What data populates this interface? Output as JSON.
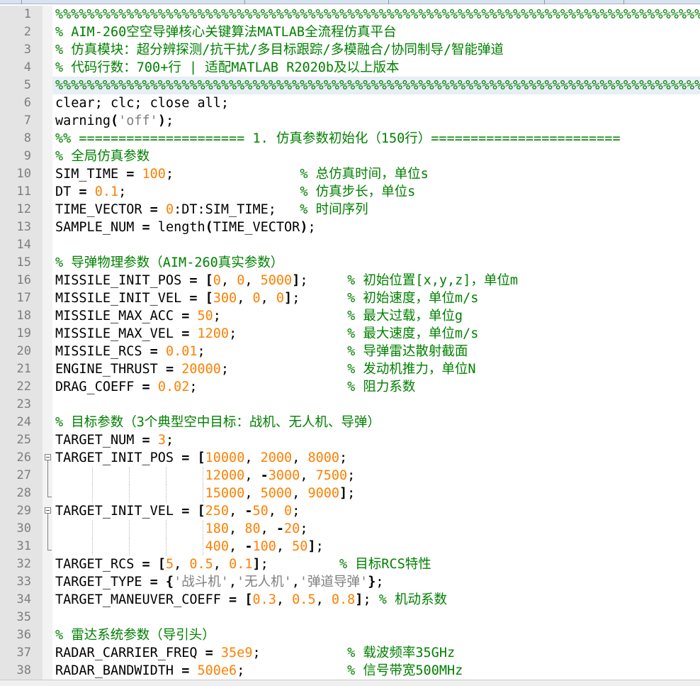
{
  "editor": {
    "current_line": 5,
    "lines": [
      {
        "n": "1",
        "tokens": [
          [
            "c-com",
            "%%%%%%%%%%%%%%%%%%%%%%%%%%%%%%%%%%%%%%%%%%%%%%%%%%%%%%%%%%%%%%%%%%%%%%%%%%%%%%%%%%%%"
          ]
        ]
      },
      {
        "n": "2",
        "tokens": [
          [
            "c-com",
            "% AIM-260空空导弹核心关键算法MATLAB全流程仿真平台"
          ]
        ]
      },
      {
        "n": "3",
        "tokens": [
          [
            "c-com",
            "% 仿真模块：超分辨探测/抗干扰/多目标跟踪/多模融合/协同制导/智能弹道"
          ]
        ]
      },
      {
        "n": "4",
        "tokens": [
          [
            "c-com",
            "% 代码行数：700+行 | 适配MATLAB R2020b及以上版本"
          ]
        ]
      },
      {
        "n": "5",
        "tokens": [
          [
            "c-com",
            "%%%%%%%%%%%%%%%%%%%%%%%%%%%%%%%%%%%%%%%%%%%%%%%%%%%%%%%%%%%%%%%%%%%%%%%%%%%%%%%%%%%%"
          ]
        ]
      },
      {
        "n": "6",
        "tokens": [
          [
            "",
            "clear; clc; close all;"
          ]
        ]
      },
      {
        "n": "7",
        "tokens": [
          [
            "",
            "warning"
          ],
          [
            "c-op",
            "("
          ],
          [
            "c-str",
            "'off'"
          ],
          [
            "c-op",
            ")"
          ],
          [
            "",
            ";"
          ]
        ]
      },
      {
        "n": "8",
        "tokens": [
          [
            "c-com",
            "%% ===================== 1. 仿真参数初始化（150行）========================"
          ]
        ]
      },
      {
        "n": "9",
        "tokens": [
          [
            "c-com",
            "% 全局仿真参数"
          ]
        ]
      },
      {
        "n": "10",
        "tokens": [
          [
            "",
            "SIM_TIME "
          ],
          [
            "c-op",
            "="
          ],
          [
            "",
            " "
          ],
          [
            "c-num",
            "100"
          ],
          [
            "",
            ";                "
          ],
          [
            "c-com",
            "% 总仿真时间，单位s"
          ]
        ]
      },
      {
        "n": "11",
        "tokens": [
          [
            "",
            "DT "
          ],
          [
            "c-op",
            "="
          ],
          [
            "",
            " "
          ],
          [
            "c-num",
            "0.1"
          ],
          [
            "",
            ";                      "
          ],
          [
            "c-com",
            "% 仿真步长，单位s"
          ]
        ]
      },
      {
        "n": "12",
        "tokens": [
          [
            "",
            "TIME_VECTOR "
          ],
          [
            "c-op",
            "="
          ],
          [
            "",
            " "
          ],
          [
            "c-num",
            "0"
          ],
          [
            "",
            ":DT:SIM_TIME;   "
          ],
          [
            "c-com",
            "% 时间序列"
          ]
        ]
      },
      {
        "n": "13",
        "tokens": [
          [
            "",
            "SAMPLE_NUM "
          ],
          [
            "c-op",
            "="
          ],
          [
            "",
            " length"
          ],
          [
            "c-op",
            "("
          ],
          [
            "",
            "TIME_VECTOR"
          ],
          [
            "c-op",
            ")"
          ],
          [
            "",
            ";"
          ]
        ]
      },
      {
        "n": "14",
        "tokens": [
          [
            "",
            ""
          ]
        ]
      },
      {
        "n": "15",
        "tokens": [
          [
            "c-com",
            "% 导弹物理参数（AIM-260真实参数）"
          ]
        ]
      },
      {
        "n": "16",
        "tokens": [
          [
            "",
            "MISSILE_INIT_POS "
          ],
          [
            "c-op",
            "= ["
          ],
          [
            "c-num",
            "0"
          ],
          [
            "",
            ", "
          ],
          [
            "c-num",
            "0"
          ],
          [
            "",
            ", "
          ],
          [
            "c-num",
            "5000"
          ],
          [
            "c-op",
            "]"
          ],
          [
            "",
            ";     "
          ],
          [
            "c-com",
            "% 初始位置[x,y,z]，单位m"
          ]
        ]
      },
      {
        "n": "17",
        "tokens": [
          [
            "",
            "MISSILE_INIT_VEL "
          ],
          [
            "c-op",
            "= ["
          ],
          [
            "c-num",
            "300"
          ],
          [
            "",
            ", "
          ],
          [
            "c-num",
            "0"
          ],
          [
            "",
            ", "
          ],
          [
            "c-num",
            "0"
          ],
          [
            "c-op",
            "]"
          ],
          [
            "",
            ";      "
          ],
          [
            "c-com",
            "% 初始速度，单位m/s"
          ]
        ]
      },
      {
        "n": "18",
        "tokens": [
          [
            "",
            "MISSILE_MAX_ACC "
          ],
          [
            "c-op",
            "="
          ],
          [
            "",
            " "
          ],
          [
            "c-num",
            "50"
          ],
          [
            "",
            ";                "
          ],
          [
            "c-com",
            "% 最大过载，单位g"
          ]
        ]
      },
      {
        "n": "19",
        "tokens": [
          [
            "",
            "MISSILE_MAX_VEL "
          ],
          [
            "c-op",
            "="
          ],
          [
            "",
            " "
          ],
          [
            "c-num",
            "1200"
          ],
          [
            "",
            ";              "
          ],
          [
            "c-com",
            "% 最大速度，单位m/s"
          ]
        ]
      },
      {
        "n": "20",
        "tokens": [
          [
            "",
            "MISSILE_RCS "
          ],
          [
            "c-op",
            "="
          ],
          [
            "",
            " "
          ],
          [
            "c-num",
            "0.01"
          ],
          [
            "",
            ";                  "
          ],
          [
            "c-com",
            "% 导弹雷达散射截面"
          ]
        ]
      },
      {
        "n": "21",
        "tokens": [
          [
            "",
            "ENGINE_THRUST "
          ],
          [
            "c-op",
            "="
          ],
          [
            "",
            " "
          ],
          [
            "c-num",
            "20000"
          ],
          [
            "",
            ";               "
          ],
          [
            "c-com",
            "% 发动机推力，单位N"
          ]
        ]
      },
      {
        "n": "22",
        "tokens": [
          [
            "",
            "DRAG_COEFF "
          ],
          [
            "c-op",
            "="
          ],
          [
            "",
            " "
          ],
          [
            "c-num",
            "0.02"
          ],
          [
            "",
            ";                   "
          ],
          [
            "c-com",
            "% 阻力系数"
          ]
        ]
      },
      {
        "n": "23",
        "tokens": [
          [
            "",
            ""
          ]
        ]
      },
      {
        "n": "24",
        "tokens": [
          [
            "c-com",
            "% 目标参数（3个典型空中目标：战机、无人机、导弹）"
          ]
        ]
      },
      {
        "n": "25",
        "tokens": [
          [
            "",
            "TARGET_NUM "
          ],
          [
            "c-op",
            "="
          ],
          [
            "",
            " "
          ],
          [
            "c-num",
            "3"
          ],
          [
            "",
            ";"
          ]
        ]
      },
      {
        "n": "26",
        "fold": "start",
        "tokens": [
          [
            "",
            "TARGET_INIT_POS "
          ],
          [
            "c-op",
            "= ["
          ],
          [
            "c-num",
            "10000"
          ],
          [
            "",
            ", "
          ],
          [
            "c-num",
            "2000"
          ],
          [
            "",
            ", "
          ],
          [
            "c-num",
            "8000"
          ],
          [
            "",
            ";"
          ]
        ]
      },
      {
        "n": "27",
        "fold": "mid",
        "tokens": [
          [
            "",
            "                   "
          ],
          [
            "c-num",
            "12000"
          ],
          [
            "",
            ", "
          ],
          [
            "c-op",
            "-"
          ],
          [
            "c-num",
            "3000"
          ],
          [
            "",
            ", "
          ],
          [
            "c-num",
            "7500"
          ],
          [
            "",
            ";"
          ]
        ]
      },
      {
        "n": "28",
        "fold": "end",
        "tokens": [
          [
            "",
            "                   "
          ],
          [
            "c-num",
            "15000"
          ],
          [
            "",
            ", "
          ],
          [
            "c-num",
            "5000"
          ],
          [
            "",
            ", "
          ],
          [
            "c-num",
            "9000"
          ],
          [
            "c-op",
            "]"
          ],
          [
            "",
            ";"
          ]
        ]
      },
      {
        "n": "29",
        "fold": "start",
        "tokens": [
          [
            "",
            "TARGET_INIT_VEL "
          ],
          [
            "c-op",
            "= ["
          ],
          [
            "c-num",
            "250"
          ],
          [
            "",
            ", "
          ],
          [
            "c-op",
            "-"
          ],
          [
            "c-num",
            "50"
          ],
          [
            "",
            ", "
          ],
          [
            "c-num",
            "0"
          ],
          [
            "",
            ";"
          ]
        ]
      },
      {
        "n": "30",
        "fold": "mid",
        "tokens": [
          [
            "",
            "                   "
          ],
          [
            "c-num",
            "180"
          ],
          [
            "",
            ", "
          ],
          [
            "c-num",
            "80"
          ],
          [
            "",
            ", "
          ],
          [
            "c-op",
            "-"
          ],
          [
            "c-num",
            "20"
          ],
          [
            "",
            ";"
          ]
        ]
      },
      {
        "n": "31",
        "fold": "end",
        "tokens": [
          [
            "",
            "                   "
          ],
          [
            "c-num",
            "400"
          ],
          [
            "",
            ", "
          ],
          [
            "c-op",
            "-"
          ],
          [
            "c-num",
            "100"
          ],
          [
            "",
            ", "
          ],
          [
            "c-num",
            "50"
          ],
          [
            "c-op",
            "]"
          ],
          [
            "",
            ";"
          ]
        ]
      },
      {
        "n": "32",
        "tokens": [
          [
            "",
            "TARGET_RCS "
          ],
          [
            "c-op",
            "= ["
          ],
          [
            "c-num",
            "5"
          ],
          [
            "",
            ", "
          ],
          [
            "c-num",
            "0.5"
          ],
          [
            "",
            ", "
          ],
          [
            "c-num",
            "0.1"
          ],
          [
            "c-op",
            "]"
          ],
          [
            "",
            ";         "
          ],
          [
            "c-com",
            "% 目标RCS特性"
          ]
        ]
      },
      {
        "n": "33",
        "tokens": [
          [
            "",
            "TARGET_TYPE "
          ],
          [
            "c-op",
            "= {"
          ],
          [
            "c-str",
            "'战斗机'"
          ],
          [
            "",
            ","
          ],
          [
            "c-str",
            "'无人机'"
          ],
          [
            "",
            ","
          ],
          [
            "c-str",
            "'弹道导弹'"
          ],
          [
            "c-op",
            "}"
          ],
          [
            "",
            ";"
          ]
        ]
      },
      {
        "n": "34",
        "tokens": [
          [
            "",
            "TARGET_MANEUVER_COEFF "
          ],
          [
            "c-op",
            "= ["
          ],
          [
            "c-num",
            "0.3"
          ],
          [
            "",
            ", "
          ],
          [
            "c-num",
            "0.5"
          ],
          [
            "",
            ", "
          ],
          [
            "c-num",
            "0.8"
          ],
          [
            "c-op",
            "]"
          ],
          [
            "",
            "; "
          ],
          [
            "c-com",
            "% 机动系数"
          ]
        ]
      },
      {
        "n": "35",
        "tokens": [
          [
            "",
            ""
          ]
        ]
      },
      {
        "n": "36",
        "tokens": [
          [
            "c-com",
            "% 雷达系统参数（导引头）"
          ]
        ]
      },
      {
        "n": "37",
        "tokens": [
          [
            "",
            "RADAR_CARRIER_FREQ "
          ],
          [
            "c-op",
            "="
          ],
          [
            "",
            " "
          ],
          [
            "c-num",
            "35e9"
          ],
          [
            "",
            ";           "
          ],
          [
            "c-com",
            "% 载波频率35GHz"
          ]
        ]
      },
      {
        "n": "38",
        "tokens": [
          [
            "",
            "RADAR_BANDWIDTH "
          ],
          [
            "c-op",
            "="
          ],
          [
            "",
            " "
          ],
          [
            "c-num",
            "500e6"
          ],
          [
            "",
            ";             "
          ],
          [
            "c-com",
            "% 信号带宽500MHz"
          ]
        ]
      }
    ]
  }
}
